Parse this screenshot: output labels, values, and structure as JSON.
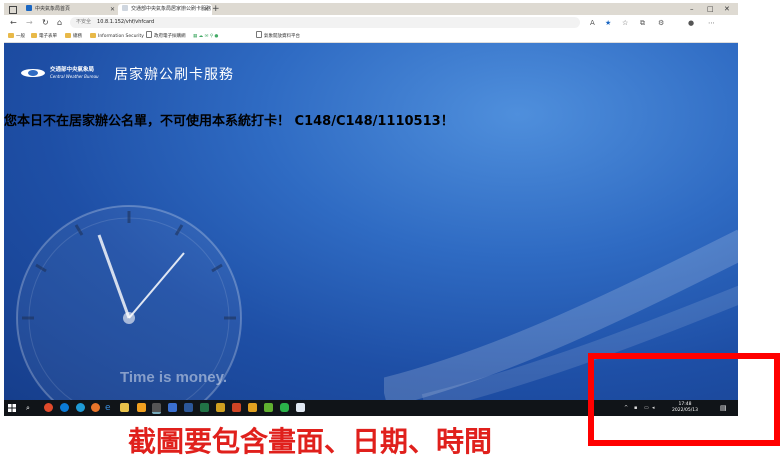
{
  "browser": {
    "tabs": [
      {
        "label": "中央氣象局首頁",
        "active": false
      },
      {
        "label": "交通部中央氣象局居家辦公刷卡服務",
        "active": true
      }
    ],
    "new_tab": "+",
    "address": {
      "warning": "不安全",
      "url": "10.8.1.152/vhf/vhfcard"
    },
    "bookmarks": [
      {
        "label": "一般"
      },
      {
        "label": "電子表單"
      },
      {
        "label": "總務"
      },
      {
        "label": "Information Security"
      },
      {
        "label": "政府電子採購網"
      },
      {
        "label": "氣象開放資料平台"
      }
    ]
  },
  "page": {
    "org_name": "交通部中央氣象局",
    "org_name_en": "Central Weather Bureau",
    "service_title": "居家辦公刷卡服務",
    "message": "您本日不在居家辦公名單，不可使用本系統打卡！ C148/C148/1110513！",
    "tagline": "Time is money."
  },
  "taskbar": {
    "time": "17:48",
    "date": "2022/05/13"
  },
  "annotation": {
    "caption": "截圖要包含畫面、日期、時間"
  },
  "colors": {
    "highlight": "#ff0000",
    "caption": "#e0201c",
    "desktop_blue": "#2f6bc3"
  }
}
